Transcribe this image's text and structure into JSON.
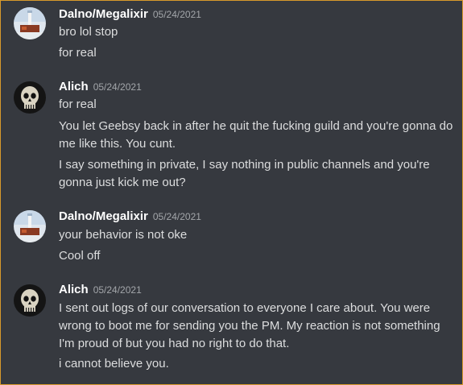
{
  "colors": {
    "background": "#36393f",
    "username": "#ffffff",
    "timestamp": "#a3a6aa",
    "message_text": "#dcddde",
    "frame_border": "#d89a2c"
  },
  "groups": [
    {
      "author": "Dalno/Megalixir",
      "timestamp": "05/24/2021",
      "avatar_icon": "lighthouse-avatar-icon",
      "messages": [
        "bro lol stop",
        "for real"
      ]
    },
    {
      "author": "Alich",
      "timestamp": "05/24/2021",
      "avatar_icon": "skull-avatar-icon",
      "messages": [
        "for real",
        "You let Geebsy back in after he quit the fucking guild and you're gonna do me like this.  You cunt.",
        "I say something in private, I say nothing in public channels and you're gonna just kick me out?"
      ]
    },
    {
      "author": "Dalno/Megalixir",
      "timestamp": "05/24/2021",
      "avatar_icon": "lighthouse-avatar-icon",
      "messages": [
        "your behavior is not oke",
        "Cool off"
      ]
    },
    {
      "author": "Alich",
      "timestamp": "05/24/2021",
      "avatar_icon": "skull-avatar-icon",
      "messages": [
        "I sent out logs of our conversation to everyone I care about. You were wrong to boot me for sending you the PM. My reaction is not something I'm proud of but you had no right to do that.",
        "i cannot believe you."
      ]
    }
  ]
}
